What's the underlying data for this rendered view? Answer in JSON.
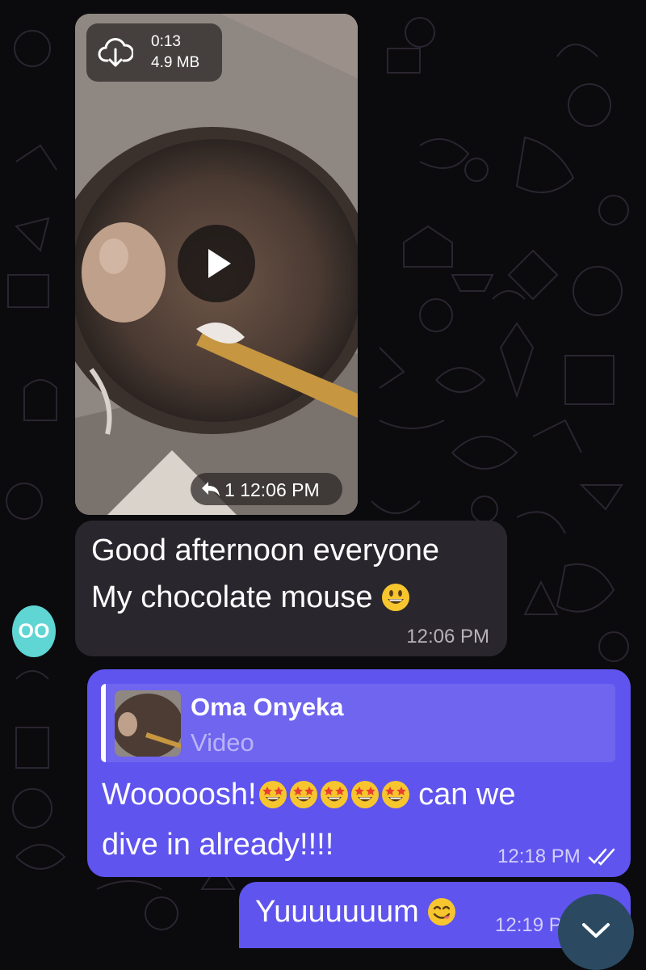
{
  "video_message": {
    "duration": "0:13",
    "size": "4.9 MB",
    "forwards": "1",
    "time": "12:06 PM"
  },
  "incoming_message": {
    "lines": [
      "Good afternoon everyone",
      "My chocolate mouse"
    ],
    "emoji": "grinning-face",
    "time": "12:06 PM",
    "sender_initials": "OO"
  },
  "outgoing_message": {
    "reply_to": {
      "name": "Oma Onyeka",
      "type": "Video"
    },
    "line1_text": "Wooooosh!",
    "line1_suffix": " can we",
    "line2_text": "dive in already!!!!",
    "emoji": [
      "star-struck",
      "star-struck",
      "star-struck",
      "star-struck",
      "star-struck"
    ],
    "time": "12:18 PM",
    "status": "read"
  },
  "outgoing_message_2": {
    "text": "Yuuuuuuum",
    "emoji": "yum-face",
    "time": "12:19 PM"
  },
  "colors": {
    "background": "#0b0a0d",
    "incoming_bubble": "#2a262d",
    "outgoing_bubble": "#5f54ee",
    "avatar": "#5fd5d4",
    "scroll_button": "#2b4a62"
  }
}
